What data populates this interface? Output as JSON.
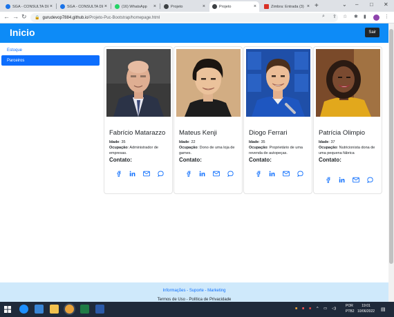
{
  "browser": {
    "tabs": [
      {
        "title": "SGA - CONSULTA DE",
        "favicon_color": "#1a73e8",
        "active": false
      },
      {
        "title": "SGA - CONSULTA DE",
        "favicon_color": "#1a73e8",
        "active": false
      },
      {
        "title": "(16) WhatsApp",
        "favicon_color": "#25d366",
        "active": false
      },
      {
        "title": "Projeto",
        "favicon_color": "#3c4043",
        "active": false
      },
      {
        "title": "Projeto",
        "favicon_color": "#3c4043",
        "active": true
      },
      {
        "title": "Zimbra: Entrada (3)",
        "favicon_color": "#d93025",
        "active": false
      }
    ],
    "url_host": "gurudevop7884.github.io",
    "url_path": "/Projeto-Puc-Bootstrap/homepage.html"
  },
  "navbar": {
    "brand": "Inicio",
    "logout_label": "Sair"
  },
  "sidebar": {
    "items": [
      {
        "label": "Estoque",
        "active": false
      },
      {
        "label": "Parceiros",
        "active": true
      }
    ]
  },
  "cards": [
    {
      "name": "Fabrício Matarazzo",
      "age_label": "Idade",
      "age": "35",
      "occupation_label": "Ocupação",
      "occupation": "Administrador de empresas.",
      "contact_label": "Contato:"
    },
    {
      "name": "Mateus Kenji",
      "age_label": "Idade",
      "age": "22",
      "occupation_label": "Ocupação",
      "occupation": "Dono de uma loja de games.",
      "contact_label": "Contato:"
    },
    {
      "name": "Diogo Ferrari",
      "age_label": "Idade",
      "age": "35",
      "occupation_label": "Ocupação",
      "occupation": "Proprietário de uma revenda de autopeças.",
      "contact_label": "Contato:"
    },
    {
      "name": "Patrícia Olimpio",
      "age_label": "Idade",
      "age": "37",
      "occupation_label": "Ocupação",
      "occupation": "Nutricionista dona de uma pequena fábrica",
      "contact_label": "Contato:"
    }
  ],
  "footer": {
    "links": "Informações - Suporte - Marketing",
    "legal": "Termos de Uso - Política de Privacidade"
  },
  "taskbar": {
    "lang": "POR",
    "lang_sub": "PTB2",
    "time": "19:01",
    "date": "10/06/2022"
  },
  "colors": {
    "primary": "#0d8bf7",
    "link": "#0d6efd",
    "dark_button": "#212529",
    "footer_bg": "#cfe9fb"
  }
}
